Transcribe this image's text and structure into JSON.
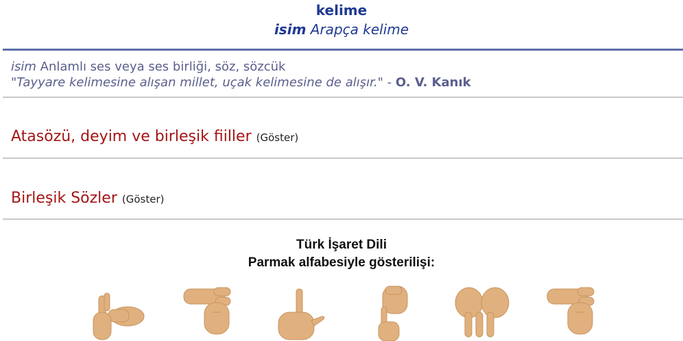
{
  "header": {
    "word": "kelime",
    "part_of_speech": "isim",
    "origin": "Arapça kelime"
  },
  "definition": {
    "part_of_speech": "isim",
    "meaning": "Anlamlı ses veya ses birliği, söz, sözcük",
    "quote_open": "\"",
    "quote_text": "Tayyare kelimesine alışan millet, uçak kelimesine de alışır.",
    "quote_close": "\" - ",
    "author": "O. V. Kanık"
  },
  "sections": [
    {
      "title": "Atasözü, deyim ve birleşik fiiller",
      "toggle": "(Göster)"
    },
    {
      "title": "Birleşik Sözler",
      "toggle": "(Göster)"
    }
  ],
  "sign_language": {
    "title": "Türk İşaret Dili",
    "subtitle": "Parmak alfabesiyle gösterilişi:",
    "letters": [
      "k",
      "e",
      "l",
      "i",
      "m",
      "e"
    ]
  },
  "colors": {
    "accent_blue": "#1f3a93",
    "section_red": "#a31515",
    "hand_skin": "#e0b07e"
  }
}
